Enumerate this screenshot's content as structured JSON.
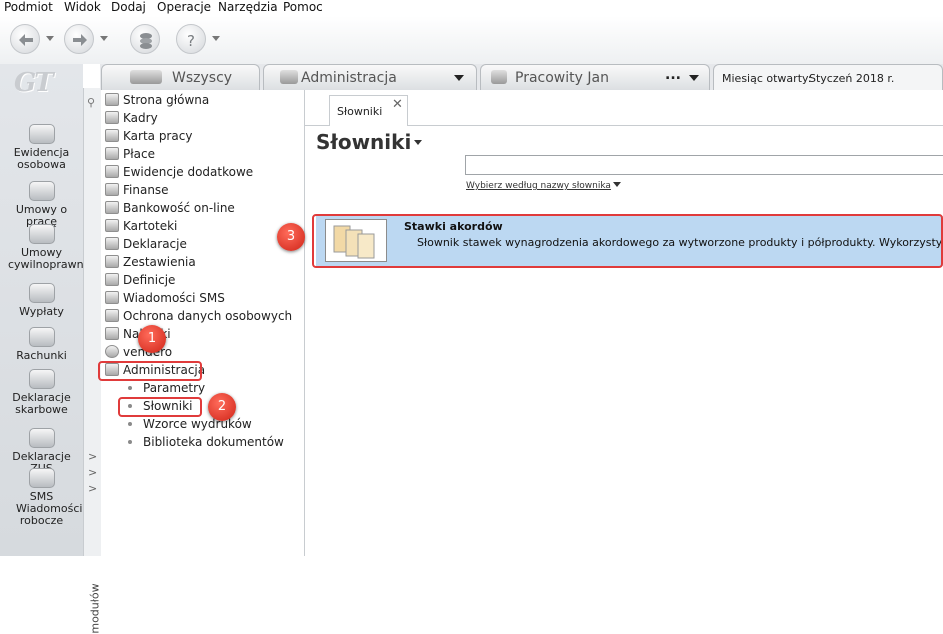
{
  "menubar": {
    "items": [
      "Podmiot",
      "Widok",
      "Dodaj",
      "Operacje",
      "Narzędzia",
      "Pomoc"
    ]
  },
  "toolbar": {
    "buttons": [
      "back-icon",
      "forward-icon",
      "stack-icon",
      "help-icon"
    ]
  },
  "logo": {
    "text": "GT"
  },
  "leftbar": {
    "items": [
      {
        "icon": "person-folder-icon",
        "label": "Ewidencja osobowa"
      },
      {
        "icon": "contract-icon",
        "label": "Umowy o pracę"
      },
      {
        "icon": "civil-contract-icon",
        "label": "Umowy cywilnoprawne"
      },
      {
        "icon": "payout-icon",
        "label": "Wypłaty"
      },
      {
        "icon": "invoice-icon",
        "label": "Rachunki"
      },
      {
        "icon": "tax-declaration-icon",
        "label": "Deklaracje skarbowe"
      },
      {
        "icon": "zus-icon",
        "label": "Deklaracje ZUS"
      },
      {
        "icon": "sms-icon",
        "label": "SMS Wiadomości robocze"
      }
    ]
  },
  "modstrip": {
    "label": "modułów"
  },
  "tabs": {
    "all": "Wszyscy",
    "admin": "Administracja",
    "worker": "Pracowity Jan",
    "worker_more": "...",
    "month_label": "Miesiąc otwarty:",
    "month_value": "Styczeń 2018 r."
  },
  "tree": {
    "items": [
      "Strona główna",
      "Kadry",
      "Karta pracy",
      "Płace",
      "Ewidencje dodatkowe",
      "Finanse",
      "Bankowość on-line",
      "Kartoteki",
      "Deklaracje",
      "Zestawienia",
      "Definicje",
      "Wiadomości SMS",
      "Ochrona danych osobowych",
      "Naklejki",
      "vendero",
      "Administracja"
    ],
    "sub_items": [
      "Parametry",
      "Słowniki",
      "Wzorce wydruków",
      "Biblioteka dokumentów"
    ]
  },
  "main": {
    "doc_tab": "Słowniki",
    "title": "Słowniki",
    "search_value": "",
    "search_link": "Wybierz według nazwy słownika",
    "result": {
      "title": "Stawki akordów",
      "description": "Słownik stawek wynagrodzenia akordowego za wytworzone produkty i półprodukty. Wykorzystywane"
    }
  },
  "annotations": [
    "1",
    "2",
    "3"
  ],
  "colors": {
    "highlight": "#bcd8f2",
    "annotation": "#e03b3b"
  }
}
